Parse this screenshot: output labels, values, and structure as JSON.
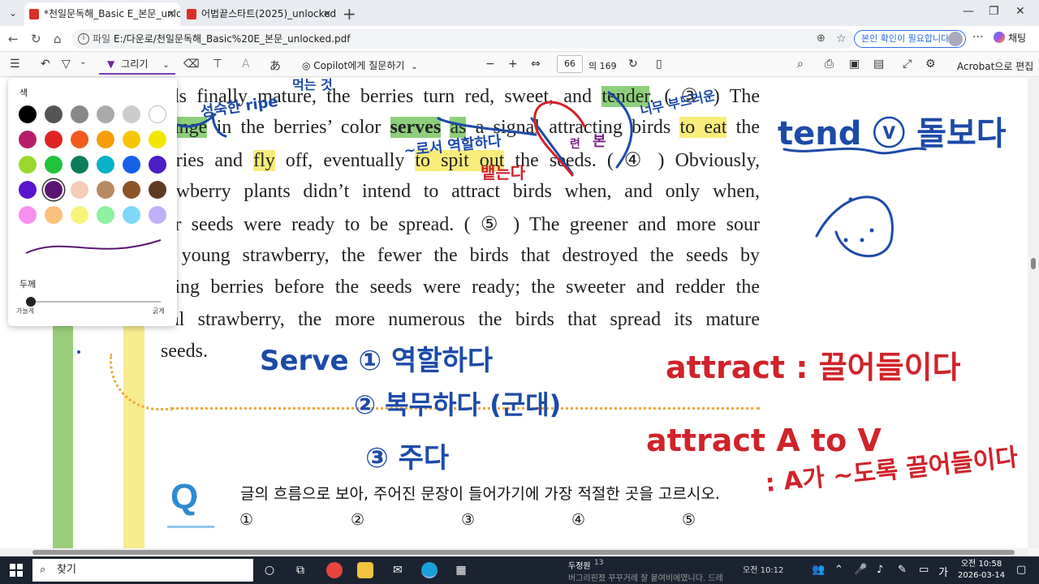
{
  "tabs": [
    {
      "title": "*천일문독해_Basic E_본문_unlocked",
      "close": "✕"
    },
    {
      "title": "어법끝스타트(2025)_unlocked.pdf",
      "close": "✕"
    }
  ],
  "address": {
    "label": "파일",
    "path": "E:/다운로/천일문독해_Basic%20E_본문_unlocked.pdf",
    "verify_label": "본인 확인이 필요합니다.",
    "chat_label": "채팅"
  },
  "toolbar": {
    "draw_label": "그리기",
    "copilot_label": "Copilot에게 질문하기",
    "page_current": "66",
    "page_total": "의 169",
    "acrobat_label": "Acrobat으로 편집"
  },
  "draw_panel": {
    "color_label": "색",
    "thickness_label": "두께",
    "min_label": "가늘게",
    "max_label": "굵게",
    "colors": [
      "#000000",
      "#555555",
      "#888888",
      "#aaaaaa",
      "#cccccc",
      "#ffffff",
      "#b81d6b",
      "#e02424",
      "#f05a1e",
      "#f59e0b",
      "#f7c600",
      "#f2e600",
      "#9ad92b",
      "#22c33a",
      "#0a7d5a",
      "#0ab0c8",
      "#1660e8",
      "#4b1fc4",
      "#5b14d0",
      "#5a1572",
      "#f3cdb5",
      "#b88a62",
      "#8a5428",
      "#5e3a22",
      "#f88ff0",
      "#fcc07a",
      "#f8f47a",
      "#8ef0a0",
      "#7fd8f8",
      "#c0b0f8"
    ],
    "selected_index": 19,
    "thickness": 0.05
  },
  "document": {
    "lines": [
      {
        "segments": [
          {
            "t": "eds finally mature, the berries turn red, sweet, and "
          },
          {
            "t": "tender",
            "hl": "g"
          },
          {
            "t": ". ( ③ ) The"
          }
        ]
      },
      {
        "segments": [
          {
            "t": "hange",
            "hl": "g"
          },
          {
            "t": " in the berries’ color "
          },
          {
            "t": "serves",
            "hl": "g",
            "b": true
          },
          {
            "t": " "
          },
          {
            "t": "as",
            "hl": "g"
          },
          {
            "t": " a signal attracting birds "
          },
          {
            "t": "to eat",
            "hl": "y"
          },
          {
            "t": " the"
          }
        ]
      },
      {
        "segments": [
          {
            "t": "erries and "
          },
          {
            "t": "fly",
            "hl": "y"
          },
          {
            "t": " off, eventually "
          },
          {
            "t": "to spit out",
            "hl": "y"
          },
          {
            "t": " the seeds. ( ④ ) Obviously,"
          }
        ]
      },
      {
        "segments": [
          {
            "t": "rawberry plants didn’t intend to attract birds when, and only when,"
          }
        ]
      },
      {
        "segments": [
          {
            "t": "eir seeds were ready to be spread. ( ⑤ ) The greener and more sour"
          }
        ]
      },
      {
        "segments": [
          {
            "t": "e young strawberry, the fewer the birds that destroyed the seeds by"
          }
        ]
      },
      {
        "segments": [
          {
            "t": "ating berries before the seeds were ready; the sweeter and redder the"
          }
        ]
      },
      {
        "segments": [
          {
            "t": "nal strawberry, the more numerous the birds that spread its mature"
          }
        ]
      },
      {
        "segments": [
          {
            "t": "seeds."
          }
        ]
      }
    ],
    "q_logo": "Q",
    "question": "글의 흐름으로 보아, 주어진 문장이 들어가기에 가장 적절한 곳을 고르시오.",
    "choices": [
      "①",
      "②",
      "③",
      "④",
      "⑤"
    ]
  },
  "annotations": {
    "blue": [
      "tend ⓥ 돌보다",
      "Serve ① 역할하다",
      "② 복무하다 (군대)",
      "③ 주다",
      "성숙한 ripe",
      "~로서 역할하다",
      "먹는 것",
      "너무 부드러운"
    ],
    "red": [
      "attract : 끌어들이다",
      "attract A to V",
      ": A가 ~도록 끌어들이다",
      "뱉는다"
    ],
    "purple": [
      "본",
      "련"
    ]
  },
  "taskbar": {
    "search_label": "찾기",
    "notif_name": "두정원",
    "notif_count": "13",
    "notif_time": "오전 10:12",
    "notif_preview": "버그리핀졌 꾸꾸거레 잘 붙여비에였니다. 드레",
    "time": "오전 10:58",
    "date": "2026-03-14"
  }
}
